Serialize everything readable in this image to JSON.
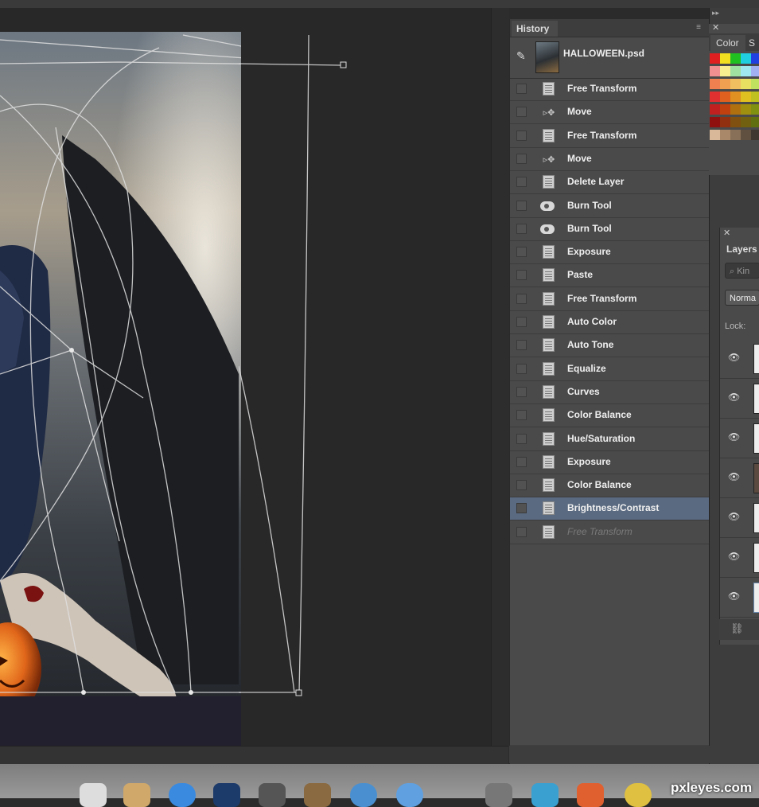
{
  "history_panel": {
    "tab_label": "History",
    "snapshot": {
      "label": "HALLOWEEN.psd"
    },
    "steps": [
      {
        "label": "Free Transform",
        "icon": "document-icon"
      },
      {
        "label": "Move",
        "icon": "move-tool-icon"
      },
      {
        "label": "Free Transform",
        "icon": "document-icon"
      },
      {
        "label": "Move",
        "icon": "move-tool-icon"
      },
      {
        "label": "Delete Layer",
        "icon": "document-icon"
      },
      {
        "label": "Burn Tool",
        "icon": "burn-tool-icon"
      },
      {
        "label": "Burn Tool",
        "icon": "burn-tool-icon"
      },
      {
        "label": "Exposure",
        "icon": "document-icon"
      },
      {
        "label": "Paste",
        "icon": "document-icon"
      },
      {
        "label": "Free Transform",
        "icon": "document-icon"
      },
      {
        "label": "Auto Color",
        "icon": "document-icon"
      },
      {
        "label": "Auto Tone",
        "icon": "document-icon"
      },
      {
        "label": "Equalize",
        "icon": "document-icon"
      },
      {
        "label": "Curves",
        "icon": "document-icon"
      },
      {
        "label": "Color Balance",
        "icon": "document-icon"
      },
      {
        "label": "Hue/Saturation",
        "icon": "document-icon"
      },
      {
        "label": "Exposure",
        "icon": "document-icon"
      },
      {
        "label": "Color Balance",
        "icon": "document-icon"
      },
      {
        "label": "Brightness/Contrast",
        "icon": "document-icon",
        "state": "selected"
      },
      {
        "label": "Free Transform",
        "icon": "document-icon",
        "state": "undone"
      }
    ],
    "footer_icons": [
      "new-document-from-state-icon",
      "camera-snapshot-icon",
      "trash-icon"
    ]
  },
  "color_panel": {
    "tab_label": "Color",
    "swatches_tab_label": "S"
  },
  "layers_panel": {
    "tab_label": "Layers",
    "kind_filter_text": "Kin",
    "blend_mode": "Norma",
    "lock_label": "Lock:"
  },
  "watermark": "pxleyes.com",
  "colors": {
    "selected_row": "#5a6a80",
    "panel_bg": "#4a4a4a",
    "canvas_bg": "#282828"
  }
}
